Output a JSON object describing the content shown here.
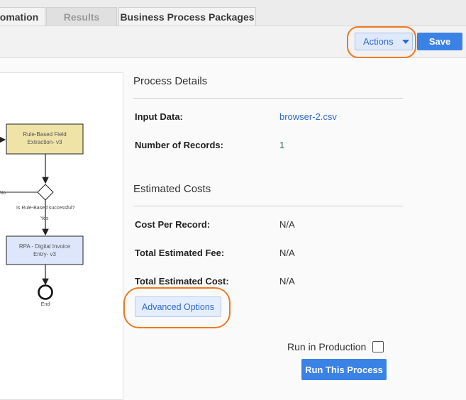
{
  "tabs": [
    {
      "label": "omation"
    },
    {
      "label": "Results"
    },
    {
      "label": "Business Process Packages"
    }
  ],
  "toolbar": {
    "actions_label": "Actions",
    "save_label": "Save"
  },
  "diagram": {
    "nodes": {
      "rule_based": "Rule-Based Field Extraction- v3",
      "rpa": "RPA - Digital Invoice Entry- v3",
      "end": "End"
    },
    "gateway": {
      "label": "Is Rule-Based successful?",
      "yes": "Yes",
      "no": "No"
    }
  },
  "process_details": {
    "title": "Process Details",
    "input_data_label": "Input Data:",
    "input_data_value": "browser-2.csv",
    "records_label": "Number of Records:",
    "records_value": "1"
  },
  "estimated_costs": {
    "title": "Estimated Costs",
    "cost_per_record_label": "Cost Per Record:",
    "cost_per_record_value": "N/A",
    "total_fee_label": "Total Estimated Fee:",
    "total_fee_value": "N/A",
    "total_cost_label": "Total Estimated Cost:",
    "total_cost_value": "N/A"
  },
  "advanced_options_label": "Advanced Options",
  "run_in_production_label": "Run in Production",
  "run_process_label": "Run This Process",
  "colors": {
    "accent": "#3b82e6",
    "highlight": "#ef7a21",
    "task_yellow": "#efe3a8",
    "task_blue": "#dde6fb"
  }
}
